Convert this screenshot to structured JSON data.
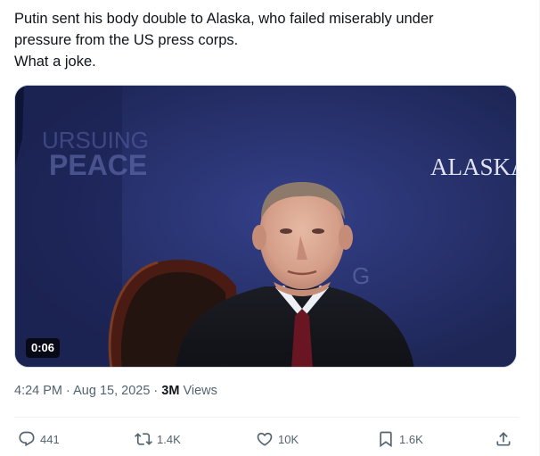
{
  "tweet": {
    "text_lines": [
      "Putin sent his body double to Alaska, who failed miserably under",
      "pressure from the US press corps.",
      "What a joke."
    ]
  },
  "media": {
    "duration": "0:06",
    "backdrop_text_1": "URSUING",
    "backdrop_text_2": "PEACE",
    "backdrop_text_right": "ALASKA",
    "backdrop_text_side": "G",
    "background_color": "#262f68"
  },
  "meta": {
    "time": "4:24 PM",
    "separator": "·",
    "date": "Aug 15, 2025",
    "views_count": "3M",
    "views_label": "Views"
  },
  "actions": {
    "replies": {
      "icon": "reply-icon",
      "count": "441"
    },
    "reposts": {
      "icon": "repost-icon",
      "count": "1.4K"
    },
    "likes": {
      "icon": "heart-icon",
      "count": "10K"
    },
    "bookmarks": {
      "icon": "bookmark-icon",
      "count": "1.6K"
    },
    "share": {
      "icon": "share-icon"
    }
  }
}
